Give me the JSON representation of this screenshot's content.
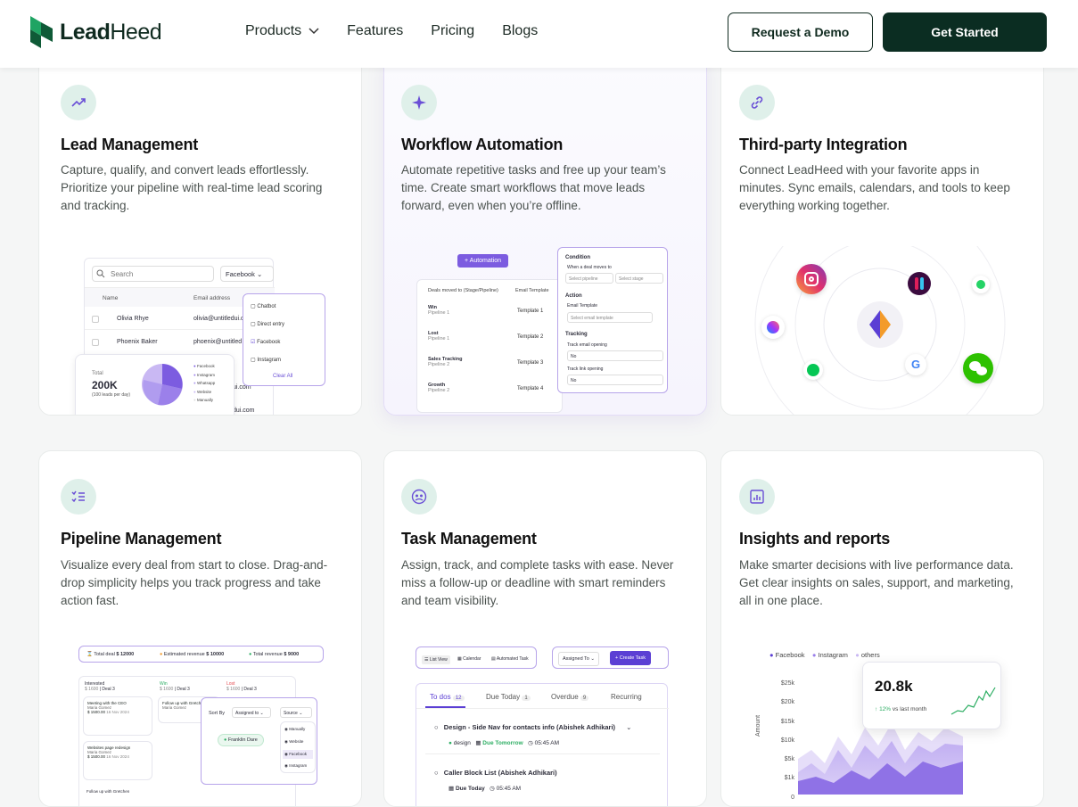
{
  "nav": {
    "logo_lead": "Lead",
    "logo_heed": "Heed",
    "products": "Products",
    "features": "Features",
    "pricing": "Pricing",
    "blogs": "Blogs",
    "demo": "Request a Demo",
    "start": "Get Started"
  },
  "cards": [
    {
      "title": "Lead Management",
      "desc": "Capture, qualify, and convert leads effortlessly. Prioritize your pipeline with real-time lead scoring and tracking.",
      "icon": "trending-up-icon"
    },
    {
      "title": "Workflow Automation",
      "desc": "Automate repetitive tasks and free up your team’s time. Create smart workflows that move leads forward, even when you’re offline.",
      "icon": "sparkle-icon"
    },
    {
      "title": "Third-party Integration",
      "desc": "Connect LeadHeed with your favorite apps in minutes. Sync emails, calendars, and tools to keep everything working together.",
      "icon": "link-icon"
    },
    {
      "title": "Pipeline Management",
      "desc": "Visualize every deal from start to close. Drag-and-drop simplicity helps you track progress and take action fast.",
      "icon": "list-check-icon"
    },
    {
      "title": "Task Management",
      "desc": "Assign, track, and complete tasks with ease. Never miss a follow-up or deadline with smart reminders and team visibility.",
      "icon": "team-icon"
    },
    {
      "title": "Insights and reports",
      "desc": "Make smarter decisions with live performance data. Get clear insights on sales, support, and marketing, all in one place.",
      "icon": "chart-icon"
    }
  ],
  "lead_ui": {
    "search": "Search",
    "filter": "Facebook",
    "col_name": "Name",
    "col_email": "Email address",
    "rows": [
      {
        "name": "Olivia Rhye",
        "email": "olivia@untitledui.c"
      },
      {
        "name": "Phoenix Baker",
        "email": "phoenix@untitled"
      }
    ],
    "options": [
      "Chatbot",
      "Direct entry",
      "Facebook",
      "Instagram"
    ],
    "clear": "Clear All",
    "total_label": "Total",
    "total_value": "200K",
    "total_sub": "(100 leads per day)",
    "legend": [
      "Facebook",
      "Instagram",
      "Whatsapp",
      "Website",
      "Manually"
    ],
    "frag1": "ui.com",
    "frag2": "dui.com"
  },
  "auto_ui": {
    "tag": "Automation",
    "col1": "Deals moved to (Stage/Pipeline)",
    "col2": "Email Template",
    "rows": [
      {
        "stage": "Win",
        "pipe": "Pipeline 1",
        "tpl": "Template 1"
      },
      {
        "stage": "Lost",
        "pipe": "Pipeline 1",
        "tpl": "Template 2"
      },
      {
        "stage": "Sales Tracking",
        "pipe": "Pipeline 2",
        "tpl": "Template 3"
      },
      {
        "stage": "Growth",
        "pipe": "Pipeline 2",
        "tpl": "Template 4"
      }
    ],
    "condition": "Condition",
    "cond_sub": "When a deal moves to",
    "sel_pipeline": "Select pipeline",
    "sel_stage": "Select stage",
    "action": "Action",
    "email_tpl": "Email Template",
    "sel_tpl": "Select email template",
    "tracking": "Tracking",
    "track_open": "Track email opening",
    "track_link": "Track link opening",
    "no1": "No",
    "no2": "No"
  },
  "pipe_ui": {
    "total_deal_label": "Total deal",
    "total_deal": "$ 12000",
    "est_label": "Estimated revenue",
    "est": "$ 10000",
    "rev_label": "Total revenue",
    "rev": "$ 9000",
    "cols": [
      {
        "name": "Interested",
        "amt": "$ 1600",
        "deals": "Deal 3"
      },
      {
        "name": "Win",
        "amt": "$ 1600",
        "deals": "Deal 3"
      },
      {
        "name": "Lost",
        "amt": "$ 1600",
        "deals": "Deal 3"
      }
    ],
    "c1": "Meeting with the CEO",
    "c1_person": "Maria Gomez",
    "c1_amt": "$ 1500.00",
    "c1_date": "16 Nov 2024",
    "c2": "Websites page redesign",
    "c2_person": "Maria Gomez",
    "c2_amt": "$ 1500.00",
    "c2_date": "16 Nov 2024",
    "c3": "Follow up with Gretchen",
    "c4": "Follow up with Gretchen",
    "c4_person": "Maria Gomez",
    "sort_by": "Sort By",
    "assigned": "Assigned to",
    "source": "Source",
    "person": "Franklin Dare",
    "sources": [
      "Manually",
      "Website",
      "Facebook",
      "Instagram"
    ]
  },
  "task_ui": {
    "list_view": "List View",
    "calendar": "Calendar",
    "automated": "Automated Task",
    "assigned": "Assigned To",
    "create": "+ Create Task",
    "tabs": [
      {
        "label": "To dos",
        "count": "12"
      },
      {
        "label": "Due Today",
        "count": "1"
      },
      {
        "label": "Overdue",
        "count": "9"
      },
      {
        "label": "Recurring",
        "count": ""
      }
    ],
    "t1": "Design - Side Nav for contacts info (Abishek Adhikari)",
    "t1_tag": "design",
    "t1_due": "Due Tomorrow",
    "t1_time": "05:45 AM",
    "t2": "Caller Block List (Abishek Adhikari)",
    "t2_due": "Due Today",
    "t2_time": "05:45 AM"
  },
  "insights_ui": {
    "legend": [
      "Facebook",
      "Instagram",
      "others"
    ],
    "yticks": [
      "$25k",
      "$20k",
      "$15k",
      "$10k",
      "$5k",
      "$1k",
      "0"
    ],
    "ylabel": "Amount",
    "kpi": "20.8k",
    "kpi_change": "12%",
    "kpi_sub": "vs last month"
  }
}
